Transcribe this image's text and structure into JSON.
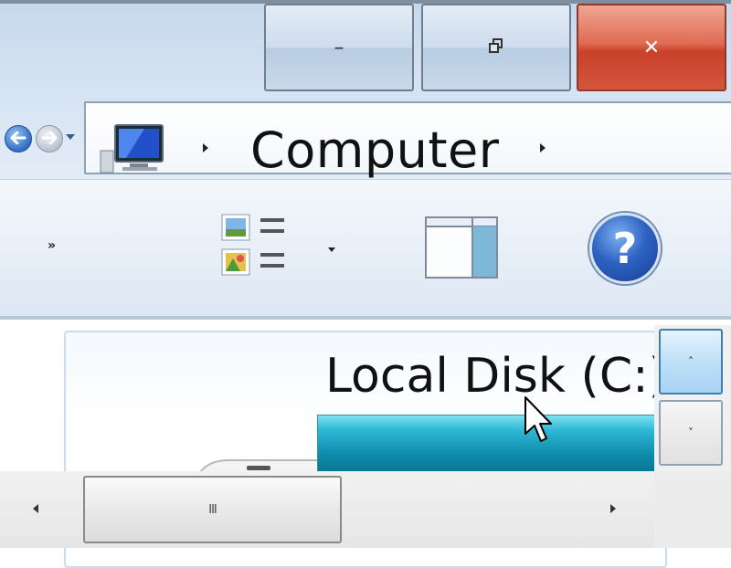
{
  "window": {
    "caption_buttons": {
      "minimize_glyph": "–",
      "maximize_glyph": "⧉",
      "close_glyph": "✕"
    }
  },
  "navigation": {
    "back_icon": "back-arrow-icon",
    "forward_icon": "forward-arrow-icon"
  },
  "address_bar": {
    "location_icon": "computer-icon",
    "breadcrumb": "Computer"
  },
  "toolbar": {
    "overflow_chevron": "»",
    "buttons": [
      "change-view",
      "preview-pane",
      "help"
    ],
    "help_glyph": "?"
  },
  "content": {
    "drives": [
      {
        "label": "Local Disk (C:)",
        "icon": "hard-drive-icon"
      }
    ]
  },
  "scrollbars": {
    "vertical": {
      "up_glyph": "˄",
      "down_glyph": "˅"
    },
    "horizontal": {
      "grip_glyph": "III"
    }
  },
  "colors": {
    "close_button": "#d4553c",
    "chrome": "#d7e4f3",
    "drive_bar": "#1aa3c4",
    "help_icon": "#2e63c4"
  }
}
